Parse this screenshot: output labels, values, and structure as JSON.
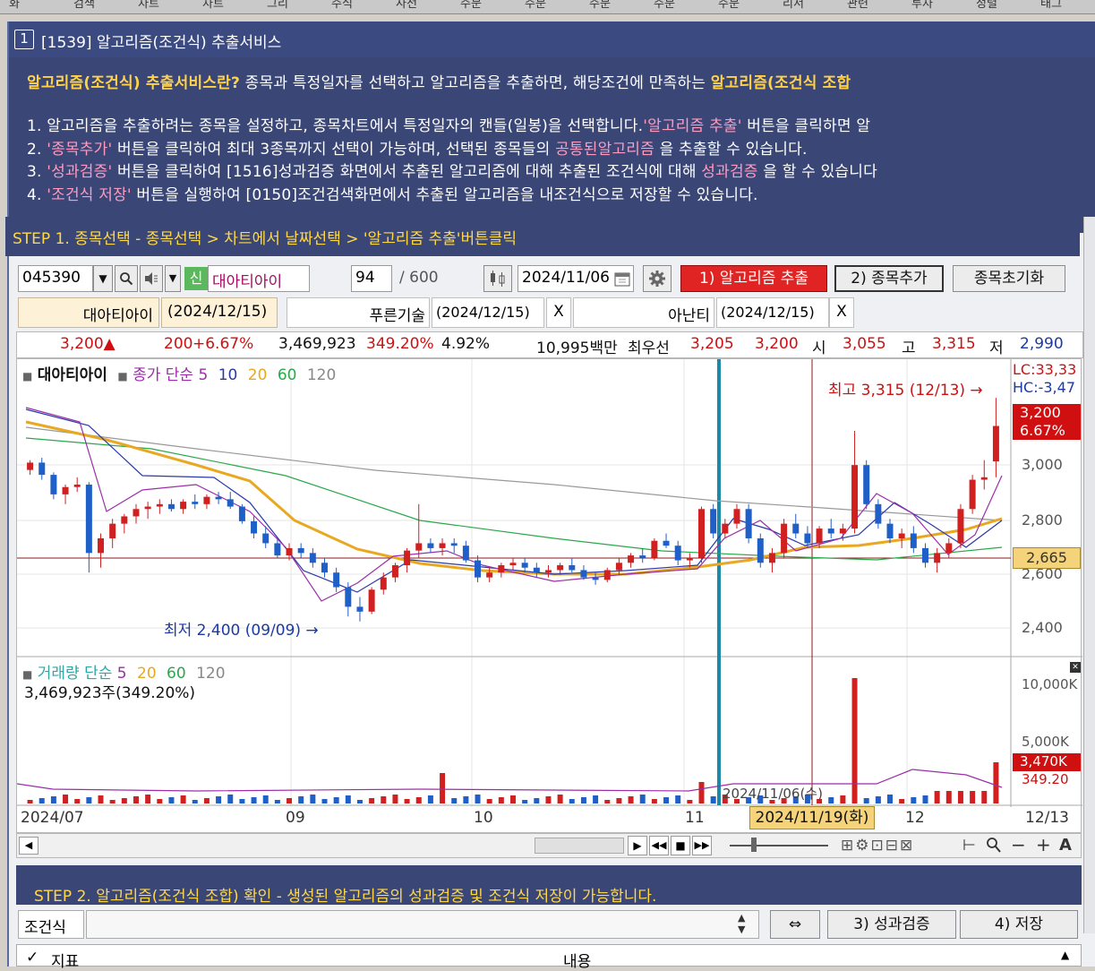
{
  "top_menu": [
    "화",
    "검색",
    "차트",
    "차트",
    "그리",
    "주식",
    "사전",
    "주문",
    "주문",
    "주문",
    "주문",
    "주문",
    "리서",
    "관련",
    "투자",
    "정렬",
    "태그"
  ],
  "window": {
    "number": "1",
    "title": "[1539] 알고리즘(조건식) 추출서비스"
  },
  "description": {
    "intro_highlight": "알고리즘(조건식) 추출서비스란?",
    "intro_text": " 종목과 특정일자를 선택하고 알고리즘을 추출하면, 해당조건에 만족하는 ",
    "intro_highlight2": "알고리즘(조건식 조합",
    "line1_a": "1. 알고리즘을 추출하려는 종목을 설정하고, 종목차트에서 특정일자의 캔들(일봉)을 선택합니다.",
    "line1_pk": "'알고리즘 추출'",
    "line1_b": " 버튼을 클릭하면 알",
    "line2_a": "2. ",
    "line2_pk": "'종목추가'",
    "line2_b": " 버튼을 클릭하여 최대 3종목까지 선택이 가능하며, 선택된 종목들의 ",
    "line2_pk2": "공통된알고리즘",
    "line2_c": " 을 추출할 수 있습니다.",
    "line3_a": "3. ",
    "line3_pk": "'성과검증'",
    "line3_b": " 버튼을 클릭하여 [1516]성과검증 화면에서 추출된 알고리즘에 대해 추출된 조건식에 대해 ",
    "line3_pk2": "성과검증",
    "line3_c": " 을 할 수 있습니다",
    "line4_a": "4. ",
    "line4_pk": "'조건식 저장'",
    "line4_b": " 버튼을 실행하여 [0150]조건검색화면에서 추출된 알고리즘을 내조건식으로 저장할 수 있습니다."
  },
  "step1": "STEP 1. 종목선택 - 종목선택 > 차트에서 날짜선택 > '알고리즘 추출'버튼클릭",
  "controls": {
    "code": "045390",
    "badge": "신",
    "stock_name": "대아티아이",
    "count": "94",
    "count_max": "/ 600",
    "date": "2024/11/06",
    "btn_extract": "1) 알고리즘 추출",
    "btn_add": "2) 종목추가",
    "btn_reset": "종목초기화"
  },
  "selected": [
    {
      "name": "대아티아이",
      "date": "(2024/12/15)"
    },
    {
      "name": "푸른기술",
      "date": "(2024/12/15)",
      "x": "X"
    },
    {
      "name": "아난티",
      "date": "(2024/12/15)",
      "x": "X"
    }
  ],
  "quote": {
    "price": "3,200▲",
    "change": "200",
    "change_pct": "+6.67%",
    "volume": "3,469,923",
    "vol_ratio": "349.20%",
    "turnover": "4.92%",
    "amount": "10,995백만",
    "bid_label": "최우선",
    "ask": "3,205",
    "bid": "3,200",
    "open_label": "시",
    "open": "3,055",
    "high_label": "고",
    "high": "3,315",
    "low_label": "저",
    "low": "2,990"
  },
  "chart": {
    "legend_name": "대아티아이",
    "legend_ma": "종가 단순",
    "ma": [
      "5",
      "10",
      "20",
      "60",
      "120"
    ],
    "ma_colors": [
      "#9b2ea8",
      "#2a3aa8",
      "#e8a820",
      "#2aa84a",
      "#888888"
    ],
    "right_top": "LC:33,33",
    "right_top2": "HC:-3,47",
    "high_note": "최고 3,315 (12/13) →",
    "low_note": "최저 2,400 (09/09) →",
    "price_label": "3,200",
    "price_pct": "6.67%",
    "cross_label": "2,665",
    "y_ticks": [
      "3,000",
      "2,800",
      "2,600",
      "2,400"
    ],
    "vol_legend": "거래량 단순",
    "vol_ma": [
      "5",
      "20",
      "60",
      "120"
    ],
    "vol_value": "3,469,923주(349.20%)",
    "vol_ticks": [
      "10,000K",
      "5,000K"
    ],
    "vol_label": "3,470K",
    "vol_pct": "349.20",
    "marker_date": "2024/11/06(수)",
    "x_labels": [
      "2024/07",
      "09",
      "10",
      "11",
      "12",
      "12/13"
    ],
    "cursor_date": "2024/11/19(화)"
  },
  "chart_data": {
    "type": "candlestick",
    "title": "대아티아이",
    "ylim": [
      2300,
      3400
    ],
    "candles": [
      [
        3020,
        3060,
        3000,
        3050
      ],
      [
        3050,
        3070,
        2980,
        3000
      ],
      [
        3000,
        3010,
        2900,
        2920
      ],
      [
        2920,
        2960,
        2880,
        2950
      ],
      [
        2950,
        2990,
        2930,
        2960
      ],
      [
        2960,
        2970,
        2600,
        2680
      ],
      [
        2680,
        2760,
        2620,
        2740
      ],
      [
        2740,
        2820,
        2700,
        2800
      ],
      [
        2800,
        2840,
        2760,
        2830
      ],
      [
        2830,
        2880,
        2800,
        2860
      ],
      [
        2860,
        2890,
        2820,
        2870
      ],
      [
        2870,
        2900,
        2840,
        2880
      ],
      [
        2880,
        2900,
        2850,
        2860
      ],
      [
        2860,
        2900,
        2840,
        2890
      ],
      [
        2890,
        2920,
        2860,
        2880
      ],
      [
        2880,
        2920,
        2860,
        2910
      ],
      [
        2910,
        2930,
        2880,
        2900
      ],
      [
        2900,
        2930,
        2860,
        2870
      ],
      [
        2870,
        2880,
        2800,
        2810
      ],
      [
        2810,
        2830,
        2740,
        2760
      ],
      [
        2760,
        2790,
        2700,
        2720
      ],
      [
        2720,
        2740,
        2660,
        2670
      ],
      [
        2670,
        2720,
        2650,
        2700
      ],
      [
        2700,
        2720,
        2660,
        2680
      ],
      [
        2680,
        2700,
        2620,
        2640
      ],
      [
        2640,
        2660,
        2580,
        2600
      ],
      [
        2600,
        2620,
        2520,
        2540
      ],
      [
        2540,
        2560,
        2420,
        2460
      ],
      [
        2460,
        2500,
        2400,
        2440
      ],
      [
        2440,
        2540,
        2430,
        2530
      ],
      [
        2530,
        2600,
        2510,
        2580
      ],
      [
        2580,
        2640,
        2560,
        2630
      ],
      [
        2630,
        2700,
        2600,
        2690
      ],
      [
        2690,
        2880,
        2660,
        2720
      ],
      [
        2720,
        2740,
        2680,
        2700
      ],
      [
        2700,
        2740,
        2670,
        2720
      ],
      [
        2720,
        2740,
        2680,
        2710
      ],
      [
        2710,
        2730,
        2640,
        2650
      ],
      [
        2650,
        2670,
        2560,
        2580
      ],
      [
        2580,
        2620,
        2560,
        2600
      ],
      [
        2600,
        2640,
        2580,
        2630
      ],
      [
        2630,
        2660,
        2610,
        2640
      ],
      [
        2640,
        2660,
        2600,
        2620
      ],
      [
        2620,
        2640,
        2580,
        2600
      ],
      [
        2600,
        2630,
        2580,
        2610
      ],
      [
        2610,
        2640,
        2590,
        2630
      ],
      [
        2630,
        2660,
        2600,
        2610
      ],
      [
        2610,
        2630,
        2570,
        2580
      ],
      [
        2580,
        2600,
        2550,
        2570
      ],
      [
        2570,
        2620,
        2560,
        2610
      ],
      [
        2610,
        2660,
        2590,
        2640
      ],
      [
        2640,
        2680,
        2620,
        2670
      ],
      [
        2670,
        2700,
        2640,
        2660
      ],
      [
        2660,
        2740,
        2650,
        2730
      ],
      [
        2730,
        2760,
        2700,
        2710
      ],
      [
        2710,
        2730,
        2630,
        2650
      ],
      [
        2650,
        2680,
        2620,
        2660
      ],
      [
        2660,
        2870,
        2640,
        2860
      ],
      [
        2860,
        2880,
        2740,
        2760
      ],
      [
        2760,
        2820,
        2740,
        2800
      ],
      [
        2800,
        2880,
        2780,
        2860
      ],
      [
        2860,
        2880,
        2720,
        2740
      ],
      [
        2740,
        2760,
        2620,
        2640
      ],
      [
        2640,
        2700,
        2600,
        2680
      ],
      [
        2680,
        2820,
        2660,
        2800
      ],
      [
        2800,
        2840,
        2740,
        2760
      ],
      [
        2760,
        2790,
        2700,
        2720
      ],
      [
        2720,
        2790,
        2700,
        2780
      ],
      [
        2780,
        2820,
        2740,
        2760
      ],
      [
        2760,
        2800,
        2730,
        2780
      ],
      [
        2780,
        3180,
        2760,
        3040
      ],
      [
        3040,
        3060,
        2860,
        2880
      ],
      [
        2880,
        2900,
        2780,
        2800
      ],
      [
        2800,
        2820,
        2720,
        2740
      ],
      [
        2740,
        2780,
        2700,
        2760
      ],
      [
        2760,
        2790,
        2680,
        2700
      ],
      [
        2700,
        2720,
        2620,
        2640
      ],
      [
        2640,
        2700,
        2600,
        2680
      ],
      [
        2680,
        2740,
        2660,
        2720
      ],
      [
        2720,
        2880,
        2700,
        2860
      ],
      [
        2860,
        3000,
        2840,
        2980
      ],
      [
        2980,
        3060,
        2940,
        2990
      ],
      [
        3055,
        3315,
        2990,
        3200
      ]
    ]
  }
}
